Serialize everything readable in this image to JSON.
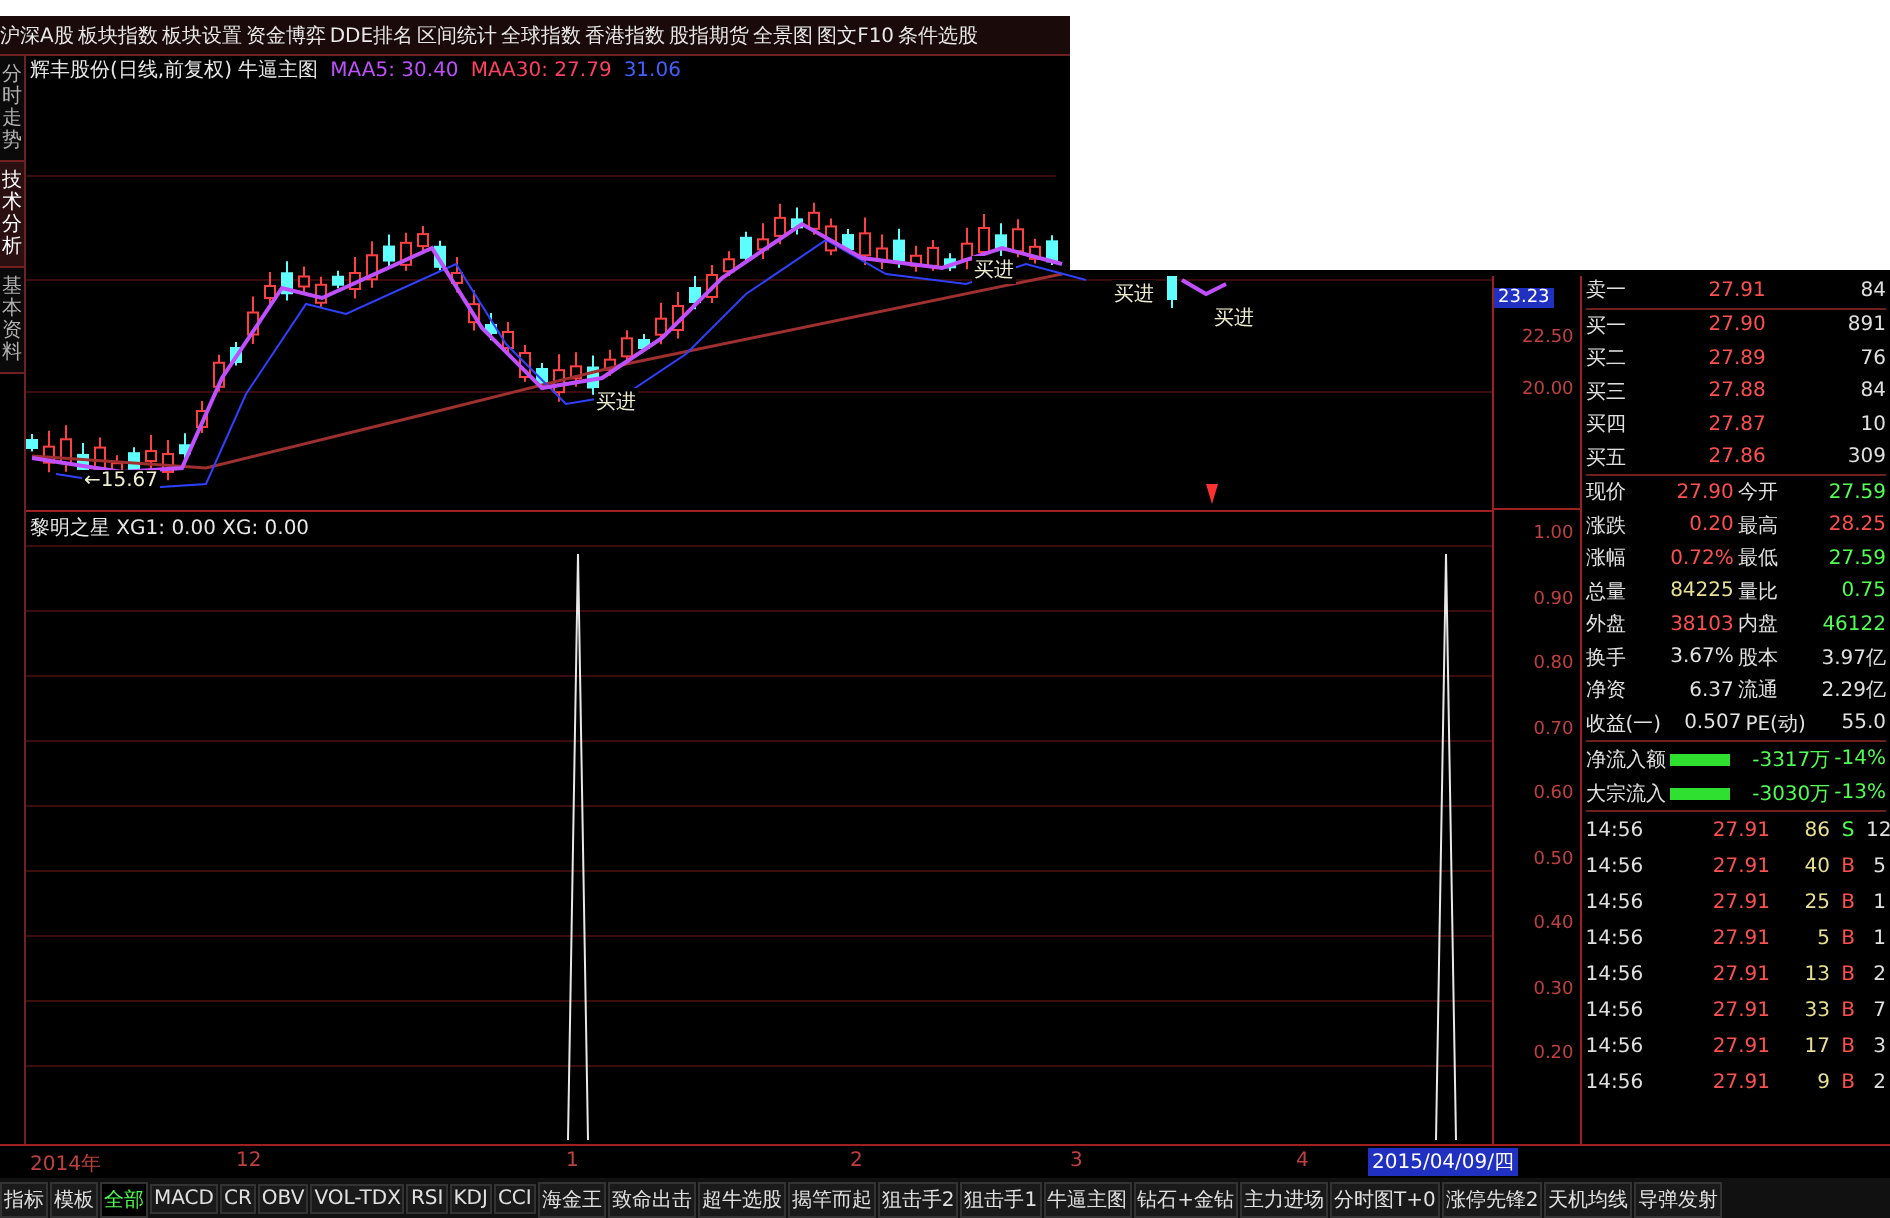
{
  "menu_bar": {
    "items": [
      "沪深A股",
      "板块指数",
      "板块设置",
      "资金博弈",
      "DDE排名",
      "区间统计",
      "全球指数",
      "香港指数",
      "股指期货",
      "全景图",
      "图文F10",
      "条件选股"
    ]
  },
  "side_tabs": [
    {
      "label": "分时走势",
      "selected": false
    },
    {
      "label": "技术分析",
      "selected": true
    },
    {
      "label": "基本资料",
      "selected": false
    }
  ],
  "chart_header": {
    "title": "辉丰股份(日线,前复权) 牛逼主图",
    "ma_values": [
      {
        "label": "MAA5: 30.40",
        "color": "#c050ff"
      },
      {
        "label": "MAA30: 27.79",
        "color": "#ff4060"
      },
      {
        "label": "31.06",
        "color": "#4060ff"
      }
    ]
  },
  "price_chart": {
    "labels": [
      "←15.67",
      "买进",
      "买进",
      "买进",
      "买进"
    ]
  },
  "price_axis": {
    "current": "23.23",
    "ticks": [
      "22.50",
      "20.00"
    ]
  },
  "indicator": {
    "title": "黎明之星 XG1: 0.00 XG: 0.00",
    "ticks": [
      "1.00",
      "0.90",
      "0.80",
      "0.70",
      "0.60",
      "0.50",
      "0.40",
      "0.30",
      "0.20"
    ]
  },
  "x_axis": {
    "labels": [
      "2014年",
      "12",
      "1",
      "2",
      "3",
      "4"
    ],
    "cursor_date": "2015/04/09/四"
  },
  "order_book": {
    "ask": {
      "label": "卖一",
      "price": "27.91",
      "volume": "84"
    },
    "bids": [
      {
        "label": "买一",
        "price": "27.90",
        "volume": "891"
      },
      {
        "label": "买二",
        "price": "27.89",
        "volume": "76"
      },
      {
        "label": "买三",
        "price": "27.88",
        "volume": "84"
      },
      {
        "label": "买四",
        "price": "27.87",
        "volume": "10"
      },
      {
        "label": "买五",
        "price": "27.86",
        "volume": "309"
      }
    ]
  },
  "quote_stats": [
    {
      "cells": [
        {
          "label": "现价",
          "value": "27.90",
          "color": "#ff5050"
        },
        {
          "label": "今开",
          "value": "27.59",
          "color": "#50ff50"
        }
      ]
    },
    {
      "cells": [
        {
          "label": "涨跌",
          "value": "0.20",
          "color": "#ff5050"
        },
        {
          "label": "最高",
          "value": "28.25",
          "color": "#ff5050"
        }
      ]
    },
    {
      "cells": [
        {
          "label": "涨幅",
          "value": "0.72%",
          "color": "#ff5050"
        },
        {
          "label": "最低",
          "value": "27.59",
          "color": "#50ff50"
        }
      ]
    },
    {
      "cells": [
        {
          "label": "总量",
          "value": "84225",
          "color": "#e8e090"
        },
        {
          "label": "量比",
          "value": "0.75",
          "color": "#50ff50"
        }
      ]
    },
    {
      "cells": [
        {
          "label": "外盘",
          "value": "38103",
          "color": "#ff5050"
        },
        {
          "label": "内盘",
          "value": "46122",
          "color": "#50ff50"
        }
      ]
    },
    {
      "cells": [
        {
          "label": "换手",
          "value": "3.67%",
          "color": "#e0e0e0"
        },
        {
          "label": "股本",
          "value": "3.97亿",
          "color": "#e0e0e0"
        }
      ]
    },
    {
      "cells": [
        {
          "label": "净资",
          "value": "6.37",
          "color": "#e0e0e0"
        },
        {
          "label": "流通",
          "value": "2.29亿",
          "color": "#e0e0e0"
        }
      ]
    },
    {
      "cells": [
        {
          "label": "收益(一)",
          "value": "0.507",
          "color": "#e0e0e0"
        },
        {
          "label": "PE(动)",
          "value": "55.0",
          "color": "#e0e0e0"
        }
      ]
    }
  ],
  "money_flow": [
    {
      "label": "净流入额",
      "amount": "-3317万",
      "ratio": "-14%"
    },
    {
      "label": "大宗流入",
      "amount": "-3030万",
      "ratio": "-13%"
    }
  ],
  "trades": [
    {
      "time": "14:56",
      "price": "27.91",
      "volume": "86",
      "side": "S",
      "color": "#50ff50",
      "count": "12"
    },
    {
      "time": "14:56",
      "price": "27.91",
      "volume": "40",
      "side": "B",
      "color": "#ff5050",
      "count": "5"
    },
    {
      "time": "14:56",
      "price": "27.91",
      "volume": "25",
      "side": "B",
      "color": "#ff5050",
      "count": "1"
    },
    {
      "time": "14:56",
      "price": "27.91",
      "volume": "5",
      "side": "B",
      "color": "#ff5050",
      "count": "1"
    },
    {
      "time": "14:56",
      "price": "27.91",
      "volume": "13",
      "side": "B",
      "color": "#ff5050",
      "count": "2"
    },
    {
      "time": "14:56",
      "price": "27.91",
      "volume": "33",
      "side": "B",
      "color": "#ff5050",
      "count": "7"
    },
    {
      "time": "14:56",
      "price": "27.91",
      "volume": "17",
      "side": "B",
      "color": "#ff5050",
      "count": "3"
    },
    {
      "time": "14:56",
      "price": "27.91",
      "volume": "9",
      "side": "B",
      "color": "#ff5050",
      "count": "2"
    }
  ],
  "indicator_tabs": [
    {
      "label": "指标",
      "selected": false
    },
    {
      "label": "模板",
      "selected": false
    },
    {
      "label": "全部",
      "selected": true
    },
    {
      "label": "MACD",
      "selected": false
    },
    {
      "label": "CR",
      "selected": false
    },
    {
      "label": "OBV",
      "selected": false
    },
    {
      "label": "VOL-TDX",
      "selected": false
    },
    {
      "label": "RSI",
      "selected": false
    },
    {
      "label": "KDJ",
      "selected": false
    },
    {
      "label": "CCI",
      "selected": false
    },
    {
      "label": "海金王",
      "selected": false
    },
    {
      "label": "致命出击",
      "selected": false
    },
    {
      "label": "超牛选股",
      "selected": false
    },
    {
      "label": "揭竿而起",
      "selected": false
    },
    {
      "label": "狙击手2",
      "selected": false
    },
    {
      "label": "狙击手1",
      "selected": false
    },
    {
      "label": "牛逼主图",
      "selected": false
    },
    {
      "label": "钻石+金钻",
      "selected": false
    },
    {
      "label": "主力进场",
      "selected": false
    },
    {
      "label": "分时图T+0",
      "selected": false
    },
    {
      "label": "涨停先锋2",
      "selected": false
    },
    {
      "label": "天机均线",
      "selected": false
    },
    {
      "label": "导弹发射",
      "selected": false
    }
  ]
}
